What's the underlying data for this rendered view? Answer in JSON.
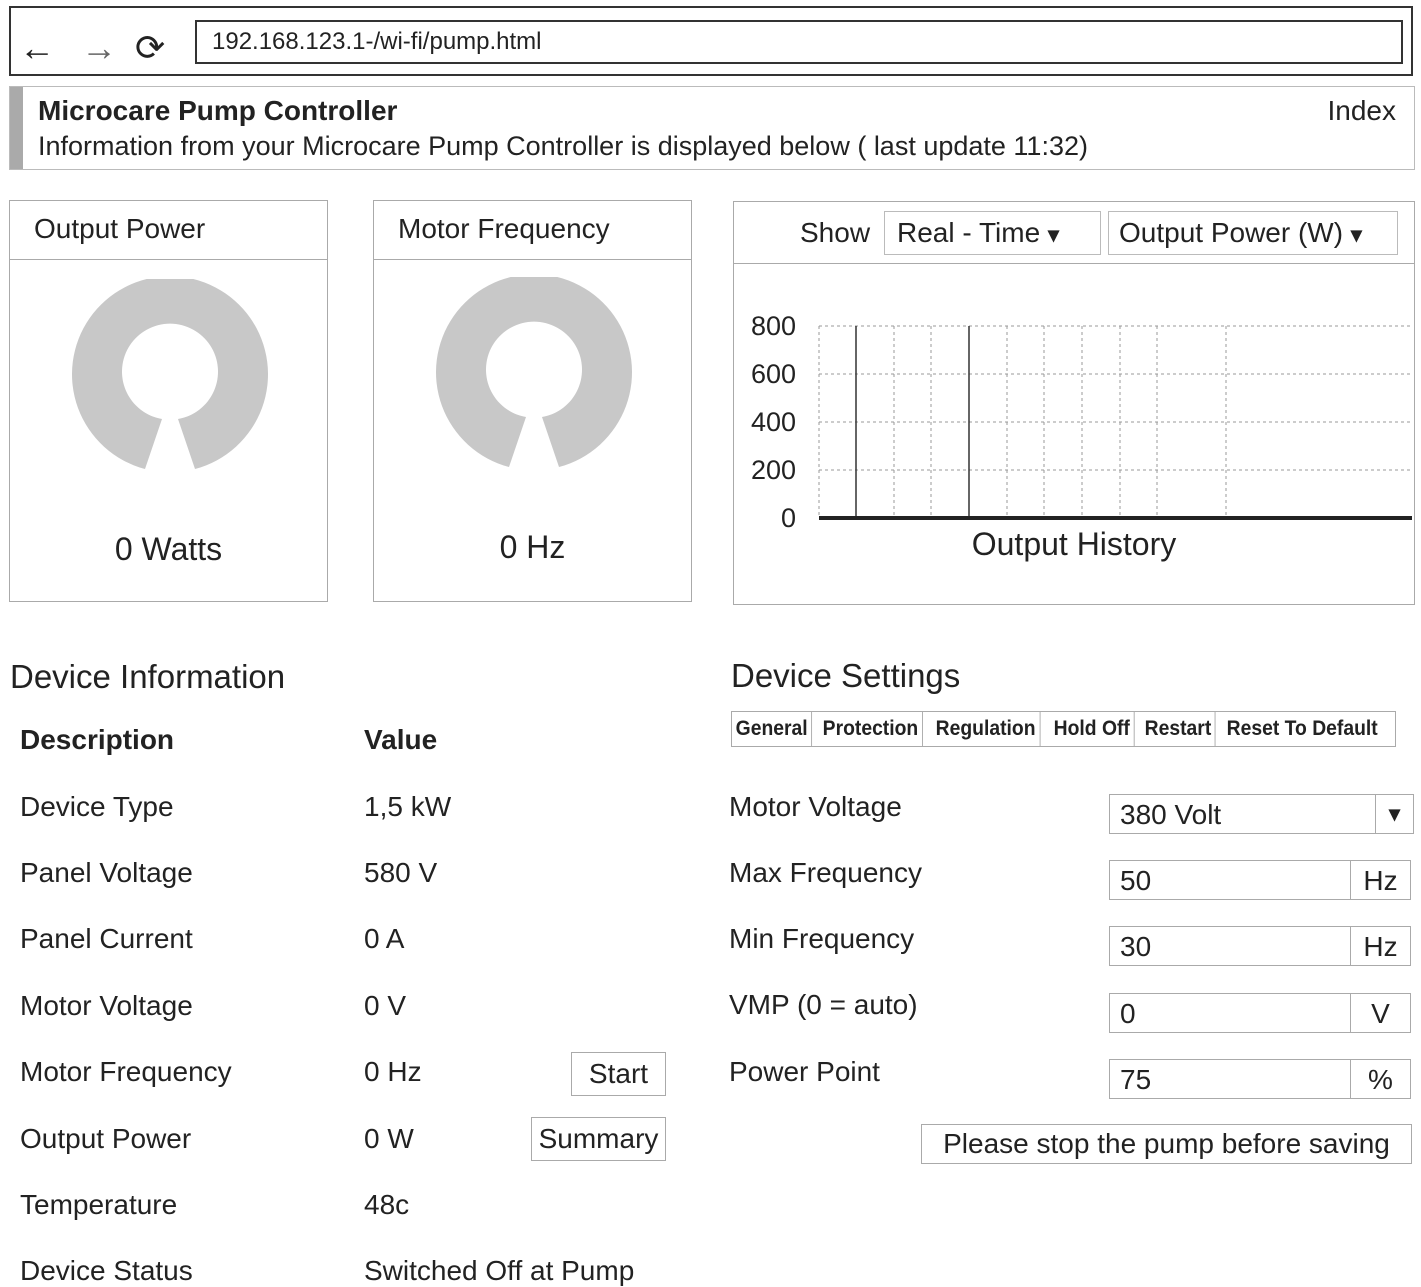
{
  "browser": {
    "back_icon": "arrow-left-icon",
    "forward_icon": "arrow-right-icon",
    "reload_icon": "reload-icon",
    "back_glyph": "←",
    "forward_glyph": "→",
    "reload_glyph": "⟳",
    "url": "192.168.123.1-/wi-fi/pump.html"
  },
  "header": {
    "title": "Microcare Pump Controller",
    "subtitle": "Information from your Microcare Pump Controller is displayed below ( last update 11:32)",
    "index_link": "Index"
  },
  "gauges": [
    {
      "title": "Output Power",
      "value_text": "0 Watts",
      "level": 0
    },
    {
      "title": "Motor Frequency",
      "value_text": "0 Hz",
      "level": 0
    }
  ],
  "chart_controls": {
    "show_label": "Show",
    "range_select": "Real - Time",
    "metric_select": "Output Power (W)"
  },
  "chart_data": {
    "type": "line",
    "title": "",
    "xlabel": "Output History",
    "ylabel": "",
    "ylim": [
      0,
      800
    ],
    "yticks": [
      "800",
      "600",
      "400",
      "200",
      "0"
    ],
    "series": [
      {
        "values": [
          0,
          0,
          0,
          0,
          0,
          0,
          0,
          0,
          0,
          0
        ]
      }
    ],
    "grid": true
  },
  "device_info": {
    "heading": "Device Information",
    "col_description": "Description",
    "col_value": "Value",
    "rows": [
      {
        "label": "Device Type",
        "value": "1,5 kW"
      },
      {
        "label": "Panel Voltage",
        "value": "580 V"
      },
      {
        "label": "Panel Current",
        "value": "0  A"
      },
      {
        "label": "Motor Voltage",
        "value": "0 V"
      },
      {
        "label": "Motor Frequency",
        "value": "0 Hz"
      },
      {
        "label": "Output Power",
        "value": "0 W"
      },
      {
        "label": "Temperature",
        "value": "48c"
      },
      {
        "label": "Device Status",
        "value": "Switched Off at Pump"
      }
    ],
    "start_button": "Start",
    "summary_button": "Summary"
  },
  "device_settings": {
    "heading": "Device Settings",
    "tabs": [
      "General",
      "Protection",
      "Regulation",
      "Hold Off",
      "Restart",
      "Reset To Default"
    ],
    "fields": [
      {
        "label": "Motor Voltage",
        "value": "380 Volt"
      },
      {
        "label": "Max Frequency",
        "value": "50",
        "unit": "Hz"
      },
      {
        "label": "Min Frequency",
        "value": "30",
        "unit": "Hz"
      },
      {
        "label": "VMP (0 = auto)",
        "value": "0",
        "unit": "V"
      },
      {
        "label": "Power Point",
        "value": "75",
        "unit": "%"
      }
    ],
    "dropdown_glyph": "▾",
    "save_button": "Please stop the pump before saving"
  }
}
